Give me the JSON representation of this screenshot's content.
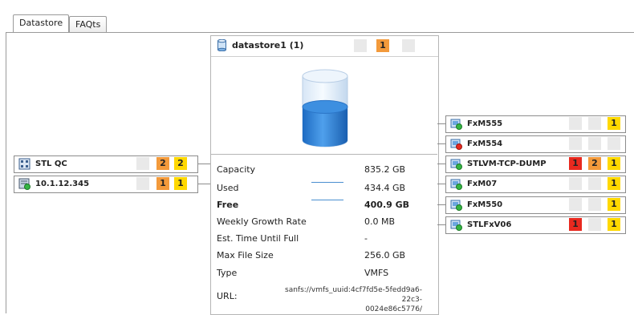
{
  "tabs": [
    {
      "label": "Datastore",
      "active": true
    },
    {
      "label": "FAQts",
      "active": false
    }
  ],
  "datastore": {
    "title": "datastore1 (1)",
    "badges": [
      {
        "value": "",
        "color": "empty"
      },
      {
        "value": "1",
        "color": "orange"
      },
      {
        "value": "",
        "color": "empty"
      }
    ],
    "fill_level": 0.52
  },
  "left_nodes": [
    {
      "label": "STL QC",
      "icon": "cluster-icon",
      "badges": [
        {
          "value": "",
          "color": "empty"
        },
        {
          "value": "2",
          "color": "orange"
        },
        {
          "value": "2",
          "color": "yellow"
        }
      ]
    },
    {
      "label": "10.1.12.345",
      "icon": "host-icon",
      "badges": [
        {
          "value": "",
          "color": "empty"
        },
        {
          "value": "1",
          "color": "orange"
        },
        {
          "value": "1",
          "color": "yellow"
        }
      ]
    }
  ],
  "right_nodes": [
    {
      "label": "FxM555",
      "icon": "vm-on-icon",
      "badges": [
        {
          "value": "",
          "color": "empty"
        },
        {
          "value": "",
          "color": "empty"
        },
        {
          "value": "1",
          "color": "yellow"
        }
      ]
    },
    {
      "label": "FxM554",
      "icon": "vm-off-icon",
      "badges": [
        {
          "value": "",
          "color": "empty"
        },
        {
          "value": "",
          "color": "empty"
        },
        {
          "value": "",
          "color": "empty"
        }
      ]
    },
    {
      "label": "STLVM-TCP-DUMP",
      "icon": "vm-on-icon",
      "badges": [
        {
          "value": "1",
          "color": "red"
        },
        {
          "value": "2",
          "color": "orange"
        },
        {
          "value": "1",
          "color": "yellow"
        }
      ]
    },
    {
      "label": "FxM07",
      "icon": "vm-on-icon",
      "badges": [
        {
          "value": "",
          "color": "empty"
        },
        {
          "value": "",
          "color": "empty"
        },
        {
          "value": "1",
          "color": "yellow"
        }
      ]
    },
    {
      "label": "FxM550",
      "icon": "vm-on-icon",
      "badges": [
        {
          "value": "",
          "color": "empty"
        },
        {
          "value": "",
          "color": "empty"
        },
        {
          "value": "1",
          "color": "yellow"
        }
      ]
    },
    {
      "label": "STLFxV06",
      "icon": "vm-on-icon",
      "badges": [
        {
          "value": "1",
          "color": "red"
        },
        {
          "value": "",
          "color": "empty"
        },
        {
          "value": "1",
          "color": "yellow"
        }
      ]
    }
  ],
  "details": {
    "capacity_label": "Capacity",
    "capacity_value": "835.2 GB",
    "used_label": "Used",
    "used_value": "434.4 GB",
    "free_label": "Free",
    "free_value": "400.9 GB",
    "growth_label": "Weekly Growth Rate",
    "growth_value": "0.0 MB",
    "time_label": "Est. Time Until Full",
    "time_value": "-",
    "maxfile_label": "Max File Size",
    "maxfile_value": "256.0 GB",
    "type_label": "Type",
    "type_value": "VMFS",
    "url_label": "URL:",
    "url_line1": "sanfs://vmfs_uuid:4cf7fd5e-5fedd9a6-22c3-",
    "url_line2": "0024e86c5776/"
  },
  "colors": {
    "blue": "#2f86d6",
    "orange": "#f39a3b",
    "yellow": "#ffd800",
    "red": "#e8291f"
  }
}
